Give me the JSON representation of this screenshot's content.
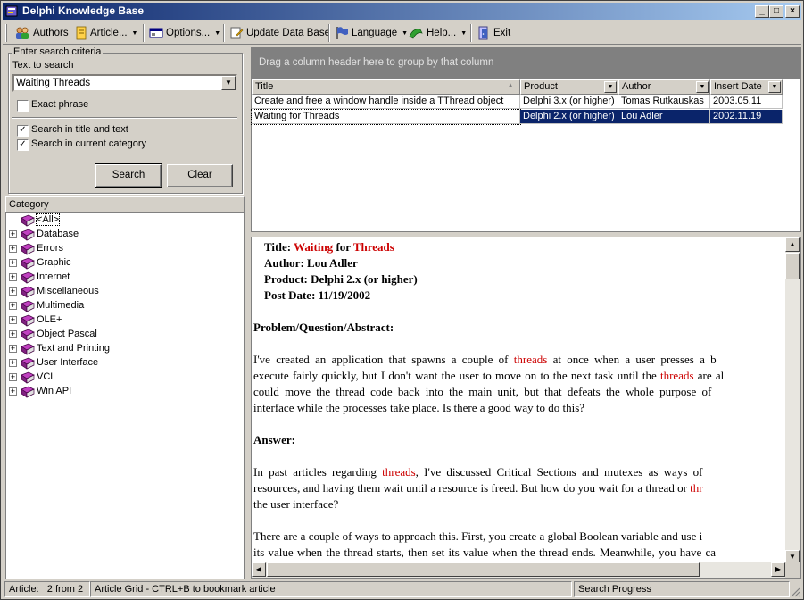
{
  "window": {
    "title": "Delphi Knowledge Base"
  },
  "toolbar": {
    "authors": "Authors",
    "article": "Article...",
    "options": "Options...",
    "update_db": "Update Data Base",
    "language": "Language",
    "help": "Help...",
    "exit": "Exit"
  },
  "search": {
    "group_title": "Enter search criteria",
    "text_label": "Text to search",
    "text_value": "Waiting Threads",
    "exact_phrase": "Exact phrase",
    "exact_checked": false,
    "title_and_text": "Search in title and text",
    "title_checked": true,
    "current_category": "Search in current category",
    "category_checked": true,
    "search_button": "Search",
    "clear_button": "Clear"
  },
  "category": {
    "header": "Category",
    "items": [
      "<All>",
      "Database",
      "Errors",
      "Graphic",
      "Internet",
      "Miscellaneous",
      "Multimedia",
      "OLE+",
      "Object Pascal",
      "Text and Printing",
      "User Interface",
      "VCL",
      "Win API"
    ]
  },
  "grid": {
    "group_hint": "Drag a column header here to group by that column",
    "columns": [
      "Title",
      "Product",
      "Author",
      "Insert Date"
    ],
    "rows": [
      [
        "Create and free a window handle inside a TThread object",
        "Delphi 3.x (or higher)",
        "Tomas Rutkauskas",
        "2003.05.11"
      ],
      [
        "Waiting for Threads",
        "Delphi 2.x (or higher)",
        "Lou Adler",
        "2002.11.19"
      ]
    ]
  },
  "article": {
    "title_label": "Title:",
    "title_w1": "Waiting",
    "title_w2": "for",
    "title_w3": "Threads",
    "author_line": "Author: Lou Adler",
    "product_line": "Product: Delphi 2.x (or higher)",
    "date_line": "Post Date: 11/19/2002",
    "problem_head": "Problem/Question/Abstract:",
    "p1a": "I've created an application that spawns a couple of ",
    "p1_hl": "threads",
    "p1b": " at once when a user presses a b",
    "p2a": "execute fairly quickly, but I don't want the user to move on to the next task until the ",
    "p2_hl": "threads",
    "p2b": " are al",
    "p3": "could move the thread code back into the main unit, but that defeats the whole purpose of",
    "p4": "interface while the processes take place. Is there a good way to do this?",
    "answer_head": "Answer:",
    "a1a": "In past articles regarding ",
    "a1_hl": "threads",
    "a1b": ", I've discussed Critical Sections and mutexes as ways of",
    "a2a": "resources, and having them wait until a resource is freed. But how do you wait for a thread or ",
    "a2_hl": "thr",
    "a3": "the user interface?",
    "b1": "There are a couple of ways to approach this. First, you create a global Boolean variable and use i",
    "b2": "its value when the thread starts, then set its value when the thread ends. Meanwhile, you have ca"
  },
  "status": {
    "article_label": "Article:",
    "article_count": "2 from 2",
    "hint": "Article Grid - CTRL+B to bookmark article",
    "progress": "Search Progress"
  }
}
